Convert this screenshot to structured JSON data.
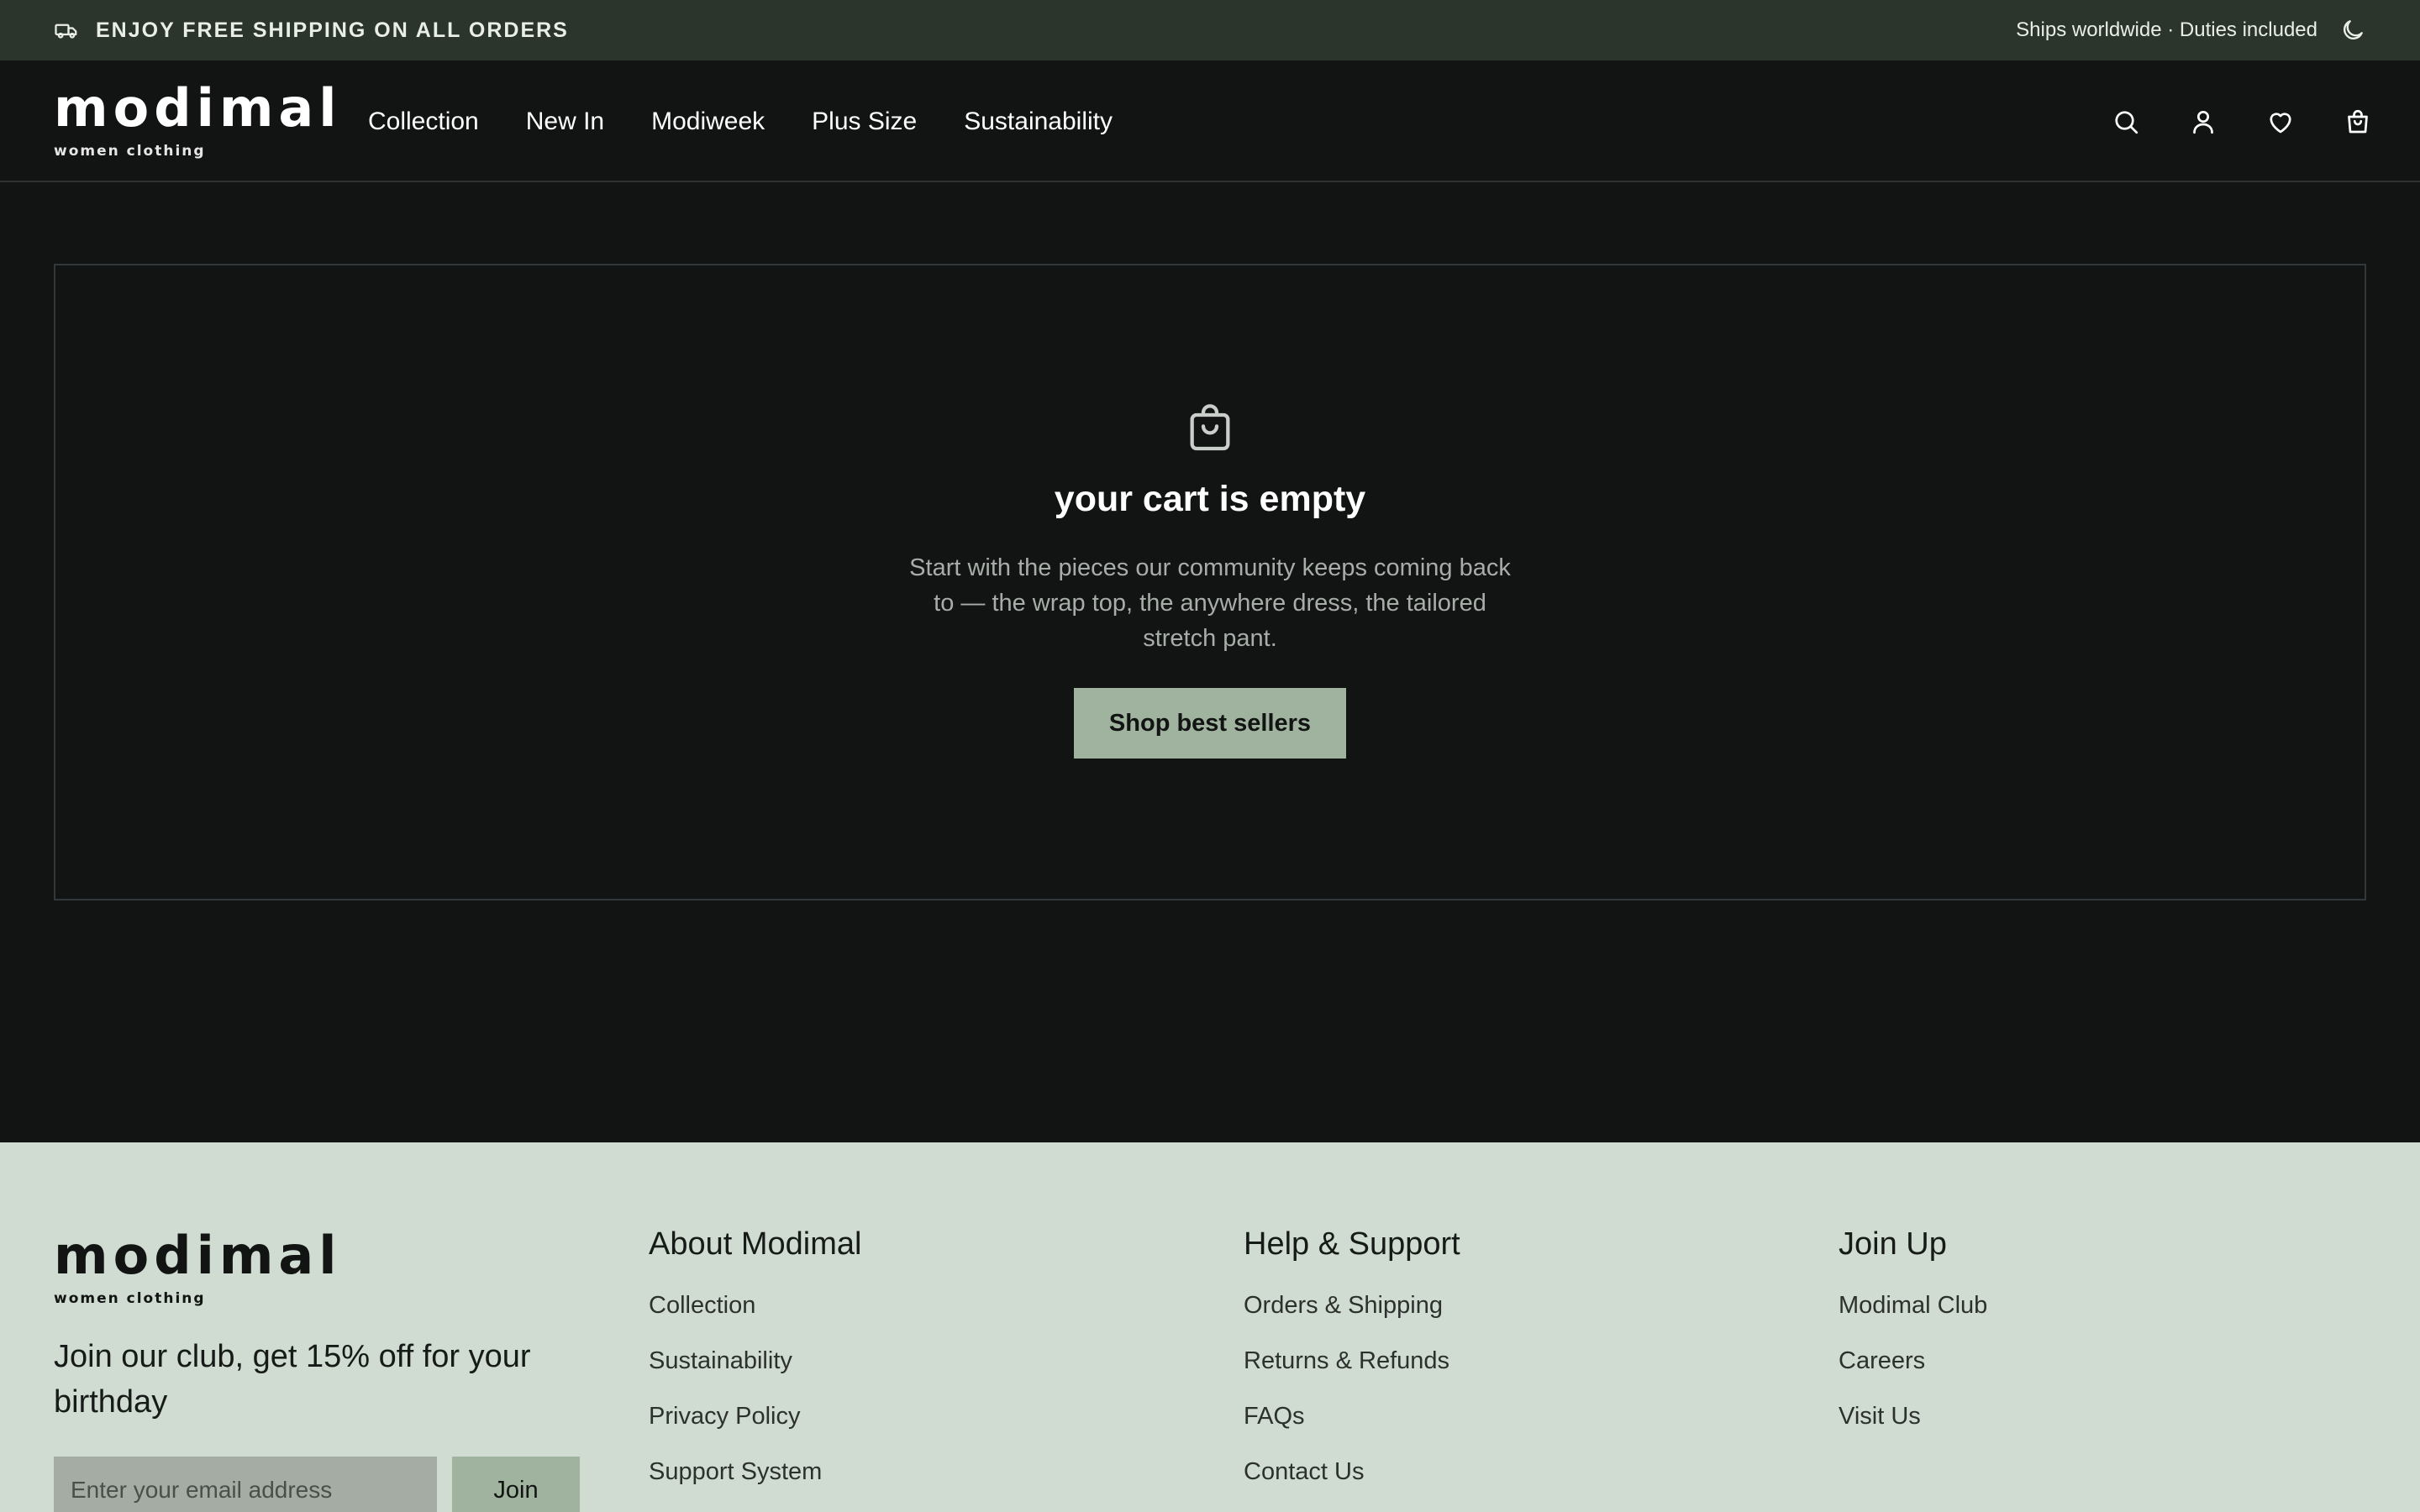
{
  "announcement": {
    "promo": "ENJOY FREE SHIPPING ON ALL ORDERS",
    "ships": "Ships worldwide · Duties included",
    "promo_icon": "truck-icon",
    "theme_icon": "moon-icon"
  },
  "header": {
    "logo": {
      "word": "modimal",
      "tagline": "women clothing"
    },
    "nav": [
      "Collection",
      "New In",
      "Modiweek",
      "Plus Size",
      "Sustainability"
    ],
    "icons": [
      "search-icon",
      "account-icon",
      "heart-icon",
      "cart-icon"
    ]
  },
  "cart": {
    "icon": "shopping-bag-icon",
    "title": "your cart is empty",
    "description": "Start with the pieces our community keeps coming back to — the wrap top, the anywhere dress, the tailored stretch pant.",
    "cta": "Shop best sellers"
  },
  "footer": {
    "logo": {
      "word": "modimal",
      "tagline": "women clothing"
    },
    "club_text": "Join our club, get 15% off for your birthday",
    "email_placeholder": "Enter your email address",
    "join_label": "Join",
    "columns": [
      {
        "title": "About Modimal",
        "links": [
          "Collection",
          "Sustainability",
          "Privacy Policy",
          "Support System"
        ]
      },
      {
        "title": "Help & Support",
        "links": [
          "Orders & Shipping",
          "Returns & Refunds",
          "FAQs",
          "Contact Us"
        ]
      },
      {
        "title": "Join Up",
        "links": [
          "Modimal Club",
          "Careers",
          "Visit Us"
        ]
      }
    ]
  },
  "colors": {
    "background": "#111412",
    "topbar": "#2c352c",
    "accent": "#9fb39e",
    "footer": "#d0dbd1"
  }
}
